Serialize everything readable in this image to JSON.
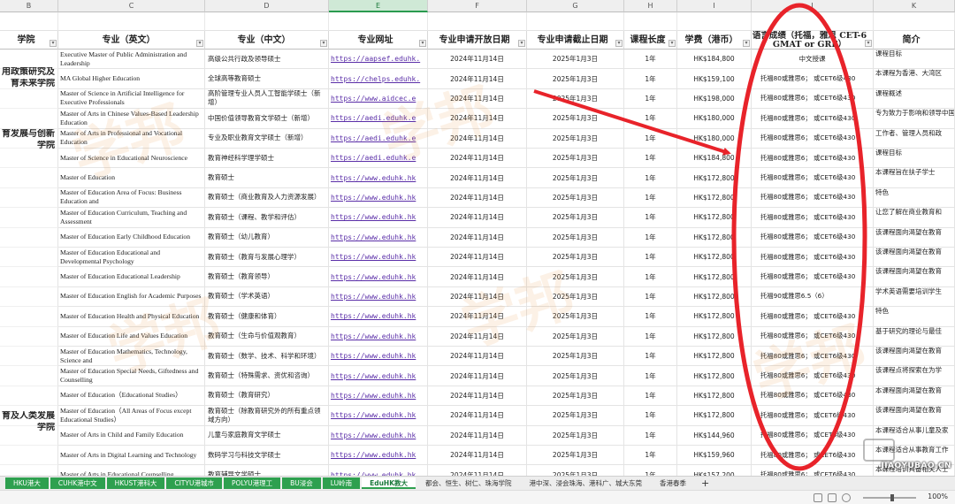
{
  "columns": [
    "B",
    "C",
    "D",
    "E",
    "F",
    "G",
    "H",
    "I",
    "J",
    "K"
  ],
  "selected_column": "E",
  "header": {
    "college": "学院",
    "program_en": "专业（英文）",
    "program_zh": "专业（中文）",
    "url": "专业网址",
    "open_date": "专业申请开放日期",
    "close_date": "专业申请截止日期",
    "duration": "课程长度",
    "tuition": "学费（港币）",
    "language": "语言成绩（托福，雅思 CET-6 GMAT or GRE）",
    "intro": "简介"
  },
  "colleges": [
    {
      "lines": [
        "用政策研究及",
        "育未来学院"
      ]
    },
    {
      "lines": [
        "育发展与创新",
        "学院"
      ]
    },
    {
      "lines": [
        "育及人类发展",
        "学院"
      ]
    }
  ],
  "rows": [
    {
      "en": "Executive Master of Public Administration and Leadership",
      "zh": "高级公共行政及领导硕士",
      "url": "https://aapsef.eduhk.",
      "open": "2024年11月14日",
      "close": "2025年1月3日",
      "dur": "1年",
      "fee": "HK$184,800",
      "lang": "中文授课",
      "intro": "课程目标"
    },
    {
      "en": "MA Global Higher Education",
      "zh": "全球高等教育硕士",
      "url": "https://chelps.eduhk.",
      "open": "2024年11月14日",
      "close": "2025年1月3日",
      "dur": "1年",
      "fee": "HK$159,100",
      "lang": "托福80或雅思6； 或CET6级430",
      "intro": "本课程为香港、大湾区"
    },
    {
      "en": "Master of Science in Artificial Intelligence for Executive Professionals",
      "zh": "高阶管理专业人员人工智能学硕士（新增）",
      "url": "https://www.aidcec.e",
      "open": "2024年11月14日",
      "close": "2025年1月3日",
      "dur": "1年",
      "fee": "HK$198,000",
      "lang": "托福80或雅思6； 或CET6级430",
      "intro": "课程概述"
    },
    {
      "en": "Master of Arts in Chinese Values-Based Leadership Education",
      "zh": "中国价值领导教育文学硕士（新增）",
      "url": "https://aedi.eduhk.e",
      "open": "2024年11月14日",
      "close": "2025年1月3日",
      "dur": "1年",
      "fee": "HK$180,000",
      "lang": "托福80或雅思6； 或CET6级430",
      "intro": "专为致力于影响和领导中国"
    },
    {
      "en": "Master of Arts in Professional and Vocational Education",
      "zh": "专业及职业教育文学硕士（新增）",
      "url": "https://aedi.eduhk.e",
      "open": "2024年11月14日",
      "close": "2025年1月3日",
      "dur": "1年",
      "fee": "HK$180,000",
      "lang": "托福80或雅思6； 或CET6级430",
      "intro": "工作者、管理人员和政"
    },
    {
      "en": "Master of Science in Educational Neuroscience",
      "zh": "教育神经科学理学硕士",
      "url": "https://aedi.eduhk.e",
      "open": "2024年11月14日",
      "close": "2025年1月3日",
      "dur": "1年",
      "fee": "HK$184,800",
      "lang": "托福80或雅思6； 或CET6级430",
      "intro": "课程目标"
    },
    {
      "en": "Master of Education",
      "zh": "教育硕士",
      "url": "https://www.eduhk.hk",
      "open": "2024年11月14日",
      "close": "2025年1月3日",
      "dur": "1年",
      "fee": "HK$172,800",
      "lang": "托福80或雅思6； 或CET6级430",
      "intro": "本课程旨在扶子学士"
    },
    {
      "en": "Master of Education Area of Focus: Business Education and",
      "zh": "教育硕士（商业教育及人力资源发展）",
      "url": "https://www.eduhk.hk",
      "open": "2024年11月14日",
      "close": "2025年1月3日",
      "dur": "1年",
      "fee": "HK$172,800",
      "lang": "托福80或雅思6； 或CET6级430",
      "intro": "特色"
    },
    {
      "en": "Master of Education Curriculum, Teaching and Assessment",
      "zh": "教育硕士（课程、教学和评估）",
      "url": "https://www.eduhk.hk",
      "open": "2024年11月14日",
      "close": "2025年1月3日",
      "dur": "1年",
      "fee": "HK$172,800",
      "lang": "托福80或雅思6； 或CET6级430",
      "intro": "让您了解在商业教育和"
    },
    {
      "en": "Master of Education Early Childhood Education",
      "zh": "教育硕士（幼儿教育）",
      "url": "https://www.eduhk.hk",
      "open": "2024年11月14日",
      "close": "2025年1月3日",
      "dur": "1年",
      "fee": "HK$172,800",
      "lang": "托福80或雅思6； 或CET6级430",
      "intro": "该课程面向渴望在教育"
    },
    {
      "en": "Master of Education Educational and Developmental Psychology",
      "zh": "教育硕士（教育与发展心理学）",
      "url": "https://www.eduhk.hk",
      "open": "2024年11月14日",
      "close": "2025年1月3日",
      "dur": "1年",
      "fee": "HK$172,800",
      "lang": "托福80或雅思6； 或CET6级430",
      "intro": "该课程面向渴望在教育"
    },
    {
      "en": "Master of Education Educational Leadership",
      "zh": "教育硕士（教育领导）",
      "url": "https://www.eduhk.hk",
      "open": "2024年11月14日",
      "close": "2025年1月3日",
      "dur": "1年",
      "fee": "HK$172,800",
      "lang": "托福80或雅思6； 或CET6级430",
      "intro": "该课程面向渴望在教育"
    },
    {
      "en": "Master of Education English for Academic Purposes",
      "zh": "教育硕士（学术英语）",
      "url": "https://www.eduhk.hk",
      "open": "2024年11月14日",
      "close": "2025年1月3日",
      "dur": "1年",
      "fee": "HK$172,800",
      "lang": "托福90或雅思6.5（6）",
      "intro": "学术英语需要培训学生"
    },
    {
      "en": "Master of Education Health and Physical Education",
      "zh": "教育硕士（健康和体育）",
      "url": "https://www.eduhk.hk",
      "open": "2024年11月14日",
      "close": "2025年1月3日",
      "dur": "1年",
      "fee": "HK$172,800",
      "lang": "托福80或雅思6； 或CET6级430",
      "intro": "特色"
    },
    {
      "en": "Master of Education Life and Values Education",
      "zh": "教育硕士（生命与价值观教育）",
      "url": "https://www.eduhk.hk",
      "open": "2024年11月14日",
      "close": "2025年1月3日",
      "dur": "1年",
      "fee": "HK$172,800",
      "lang": "托福80或雅思6； 或CET6级430",
      "intro": "基于研究的理论与最佳"
    },
    {
      "en": "Master of Education Mathematics, Technology, Science and",
      "zh": "教育硕士（数学、技术、科学和环境）",
      "url": "https://www.eduhk.hk",
      "open": "2024年11月14日",
      "close": "2025年1月3日",
      "dur": "1年",
      "fee": "HK$172,800",
      "lang": "托福80或雅思6； 或CET6级430",
      "intro": "该课程面向渴望在教育"
    },
    {
      "en": "Master of Education Special Needs, Giftedness and Counselling",
      "zh": "教育硕士（特殊需求、资优和咨询）",
      "url": "https://www.eduhk.hk",
      "open": "2024年11月14日",
      "close": "2025年1月3日",
      "dur": "1年",
      "fee": "HK$172,800",
      "lang": "托福80或雅思6； 或CET6级430",
      "intro": "该课程点将探索在为学"
    },
    {
      "en": "Master of Education（Educational Studies）",
      "zh": "教育硕士（教育研究）",
      "url": "https://www.eduhk.hk",
      "open": "2024年11月14日",
      "close": "2025年1月3日",
      "dur": "1年",
      "fee": "HK$172,800",
      "lang": "托福80或雅思6； 或CET6级430",
      "intro": "本课程面向渴望在教育"
    },
    {
      "en": "Master of Education（All Areas of Focus except Educational Studies）",
      "zh": "教育硕士（除教育研究外的所有重点领域方向）",
      "url": "https://www.eduhk.hk",
      "open": "2024年11月14日",
      "close": "2025年1月3日",
      "dur": "1年",
      "fee": "HK$172,800",
      "lang": "托福80或雅思6； 或CET6级430",
      "intro": "该课程面向渴望在教育"
    },
    {
      "en": "Master of Arts in Child and Family Education",
      "zh": "儿童与家庭教育文学硕士",
      "url": "https://www.eduhk.hk",
      "open": "2024年11月14日",
      "close": "2025年1月3日",
      "dur": "1年",
      "fee": "HK$144,960",
      "lang": "托福80或雅思6； 或CET6级430",
      "intro": "本课程适合从事儿童及家"
    },
    {
      "en": "Master of Arts in Digital Learning and Technology",
      "zh": "数码学习与科技文学硕士",
      "url": "https://www.eduhk.hk",
      "open": "2024年11月14日",
      "close": "2025年1月3日",
      "dur": "1年",
      "fee": "HK$159,960",
      "lang": "托福80或雅思6； 或CET6级430",
      "intro": "本课程适合从事教育工作"
    },
    {
      "en": "Master of Arts in Educational Counselling",
      "zh": "教育辅导文学硕士",
      "url": "https://www.eduhk.hk",
      "open": "2024年11月14日",
      "close": "2025年1月3日",
      "dur": "1年",
      "fee": "HK$157,200",
      "lang": "托福80或雅思6； 或CET6级430",
      "intro": "本课程培训具备相关人士"
    }
  ],
  "tabs": [
    {
      "label": "HKU港大",
      "style": "green"
    },
    {
      "label": "CUHK港中文",
      "style": "green"
    },
    {
      "label": "HKUST港科大",
      "style": "green"
    },
    {
      "label": "CITYU港城市",
      "style": "green"
    },
    {
      "label": "POLYU港理工",
      "style": "green"
    },
    {
      "label": "BU浸会",
      "style": "green"
    },
    {
      "label": "LU岭南",
      "style": "green"
    },
    {
      "label": "EduHK教大",
      "style": "active"
    },
    {
      "label": "都会、恒生、树仁、珠海学院",
      "style": "plain"
    },
    {
      "label": "港中深、浸会珠海、港科广、城大东莞",
      "style": "plain"
    },
    {
      "label": "香港春季",
      "style": "plain"
    }
  ],
  "add_tab_icon": "plus-icon",
  "zoom": "100%",
  "zoom_fraction": 0.55,
  "watermark_text": "学邦",
  "watermark_site": "JIAOYUBAO.CN",
  "annotation": {
    "color": "#e8232a",
    "shapes": [
      "ellipse-highlight",
      "arrow"
    ]
  }
}
